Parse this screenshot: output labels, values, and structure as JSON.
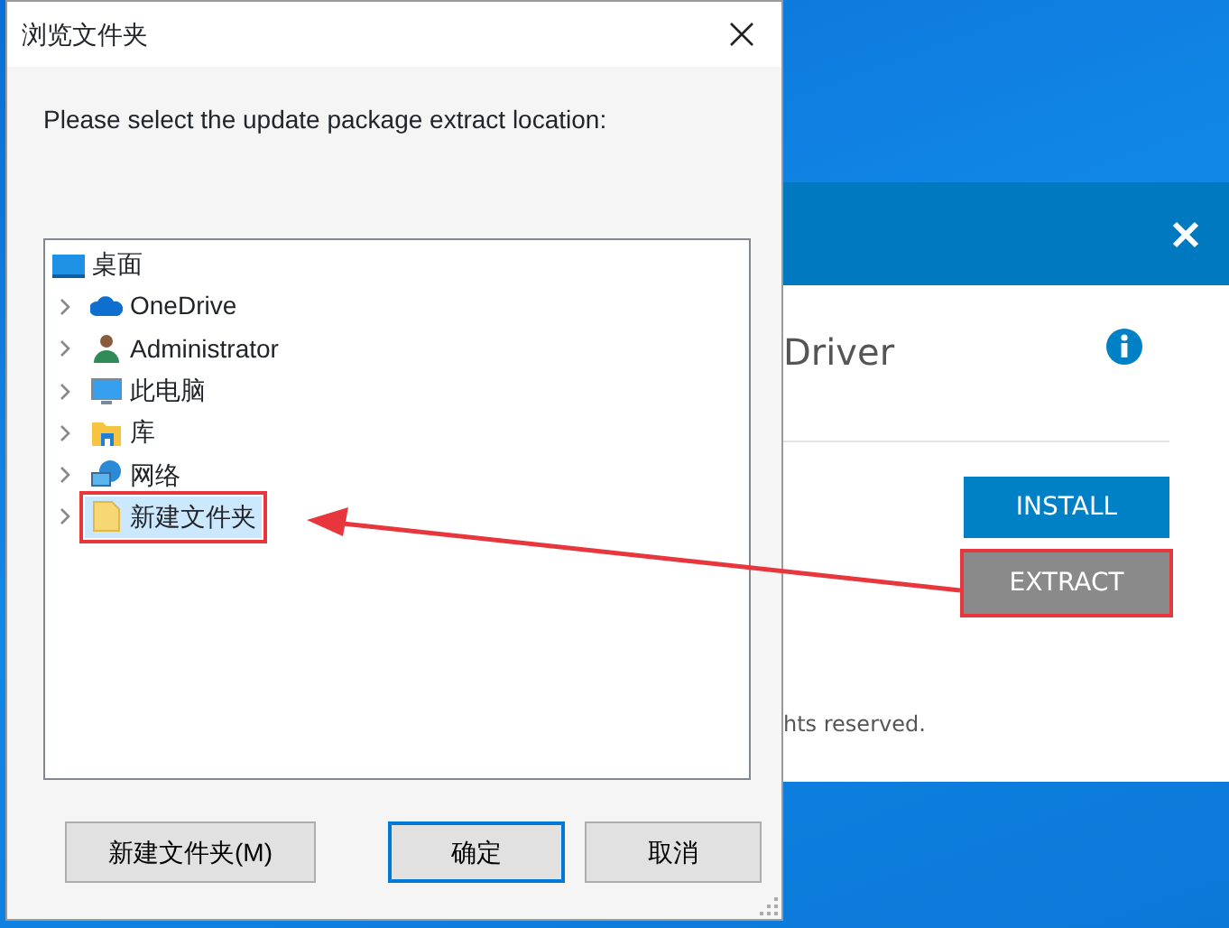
{
  "dialog": {
    "title": "浏览文件夹",
    "prompt": "Please select the update package extract location:",
    "tree": {
      "label": "桌面",
      "kind": "desktop",
      "selected": false,
      "children": [
        {
          "label": "OneDrive",
          "kind": "cloud",
          "expandable": true,
          "selected": false,
          "annotated": false
        },
        {
          "label": "Administrator",
          "kind": "user",
          "expandable": true,
          "selected": false,
          "annotated": false
        },
        {
          "label": "此电脑",
          "kind": "computer",
          "expandable": true,
          "selected": false,
          "annotated": false
        },
        {
          "label": "库",
          "kind": "library",
          "expandable": true,
          "selected": false,
          "annotated": false
        },
        {
          "label": "网络",
          "kind": "network",
          "expandable": true,
          "selected": false,
          "annotated": false
        },
        {
          "label": "新建文件夹",
          "kind": "folder",
          "expandable": true,
          "selected": true,
          "annotated": true
        }
      ]
    },
    "buttons": [
      {
        "label": "新建文件夹(M)",
        "default": false
      },
      {
        "label": "确定",
        "default": true
      },
      {
        "label": "取消",
        "default": false
      }
    ]
  },
  "installer": {
    "heading": "Driver",
    "buttons": [
      {
        "label": "INSTALL",
        "kind": "primary",
        "annotated": false
      },
      {
        "label": "EXTRACT",
        "kind": "secondary",
        "annotated": true
      }
    ],
    "footer": "hts reserved."
  },
  "annotation_arrow": true
}
